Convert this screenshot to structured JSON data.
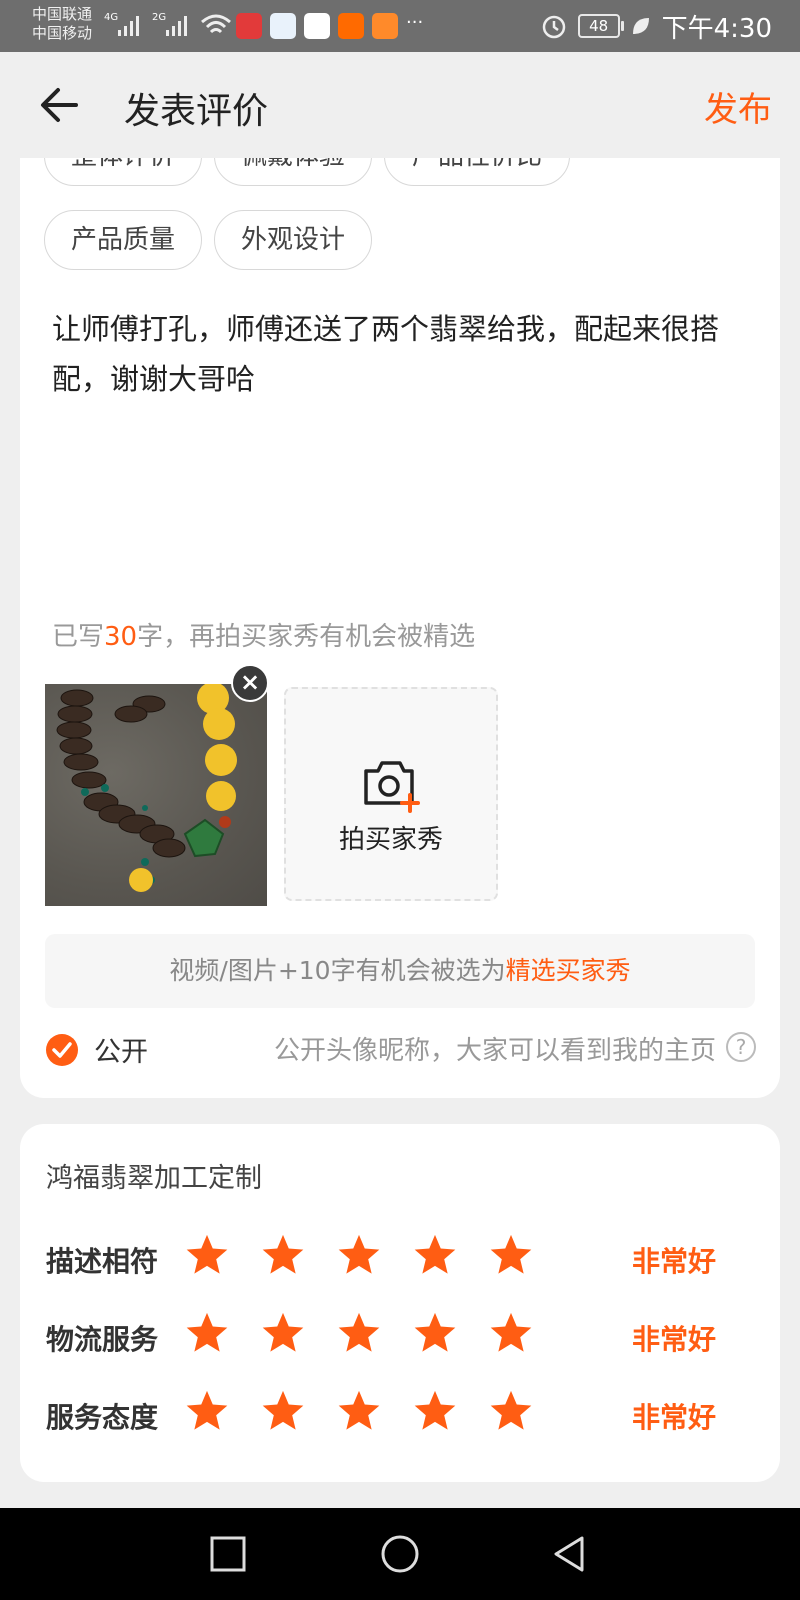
{
  "status_bar": {
    "carrier1": "中国联通",
    "carrier2": "中国移动",
    "net1": "4G",
    "net2": "2G",
    "more": "···",
    "battery": "48",
    "time": "下午4:30"
  },
  "header": {
    "title": "发表评价",
    "publish_label": "发布"
  },
  "tags": [
    "整体评价",
    "佩戴体验",
    "产品性价比",
    "产品质量",
    "外观设计"
  ],
  "review": {
    "text": "让师傅打孔，师傅还送了两个翡翠给我，配起来很搭配，谢谢大哥哈",
    "count_prefix": "已写",
    "count": "30",
    "count_suffix": "字，再拍买家秀有机会被精选"
  },
  "media": {
    "add_label": "拍买家秀",
    "tip_text": "视频/图片+10字有机会被选为",
    "tip_highlight": "精选买家秀"
  },
  "privacy": {
    "label": "公开",
    "description": "公开头像昵称，大家可以看到我的主页",
    "checked": true
  },
  "shop": {
    "name": "鸿福翡翠加工定制",
    "ratings": [
      {
        "label": "描述相符",
        "stars": 5,
        "max": 5,
        "value": "非常好"
      },
      {
        "label": "物流服务",
        "stars": 5,
        "max": 5,
        "value": "非常好"
      },
      {
        "label": "服务态度",
        "stars": 5,
        "max": 5,
        "value": "非常好"
      }
    ]
  },
  "colors": {
    "accent": "#ff5d13",
    "status_bar": "#6e6e6e",
    "background": "#efefef"
  },
  "icons": [
    "back-arrow-icon",
    "camera-plus-icon",
    "close-icon",
    "check-icon",
    "help-icon",
    "star-icon",
    "nav-recents-icon",
    "nav-home-icon",
    "nav-back-icon"
  ]
}
